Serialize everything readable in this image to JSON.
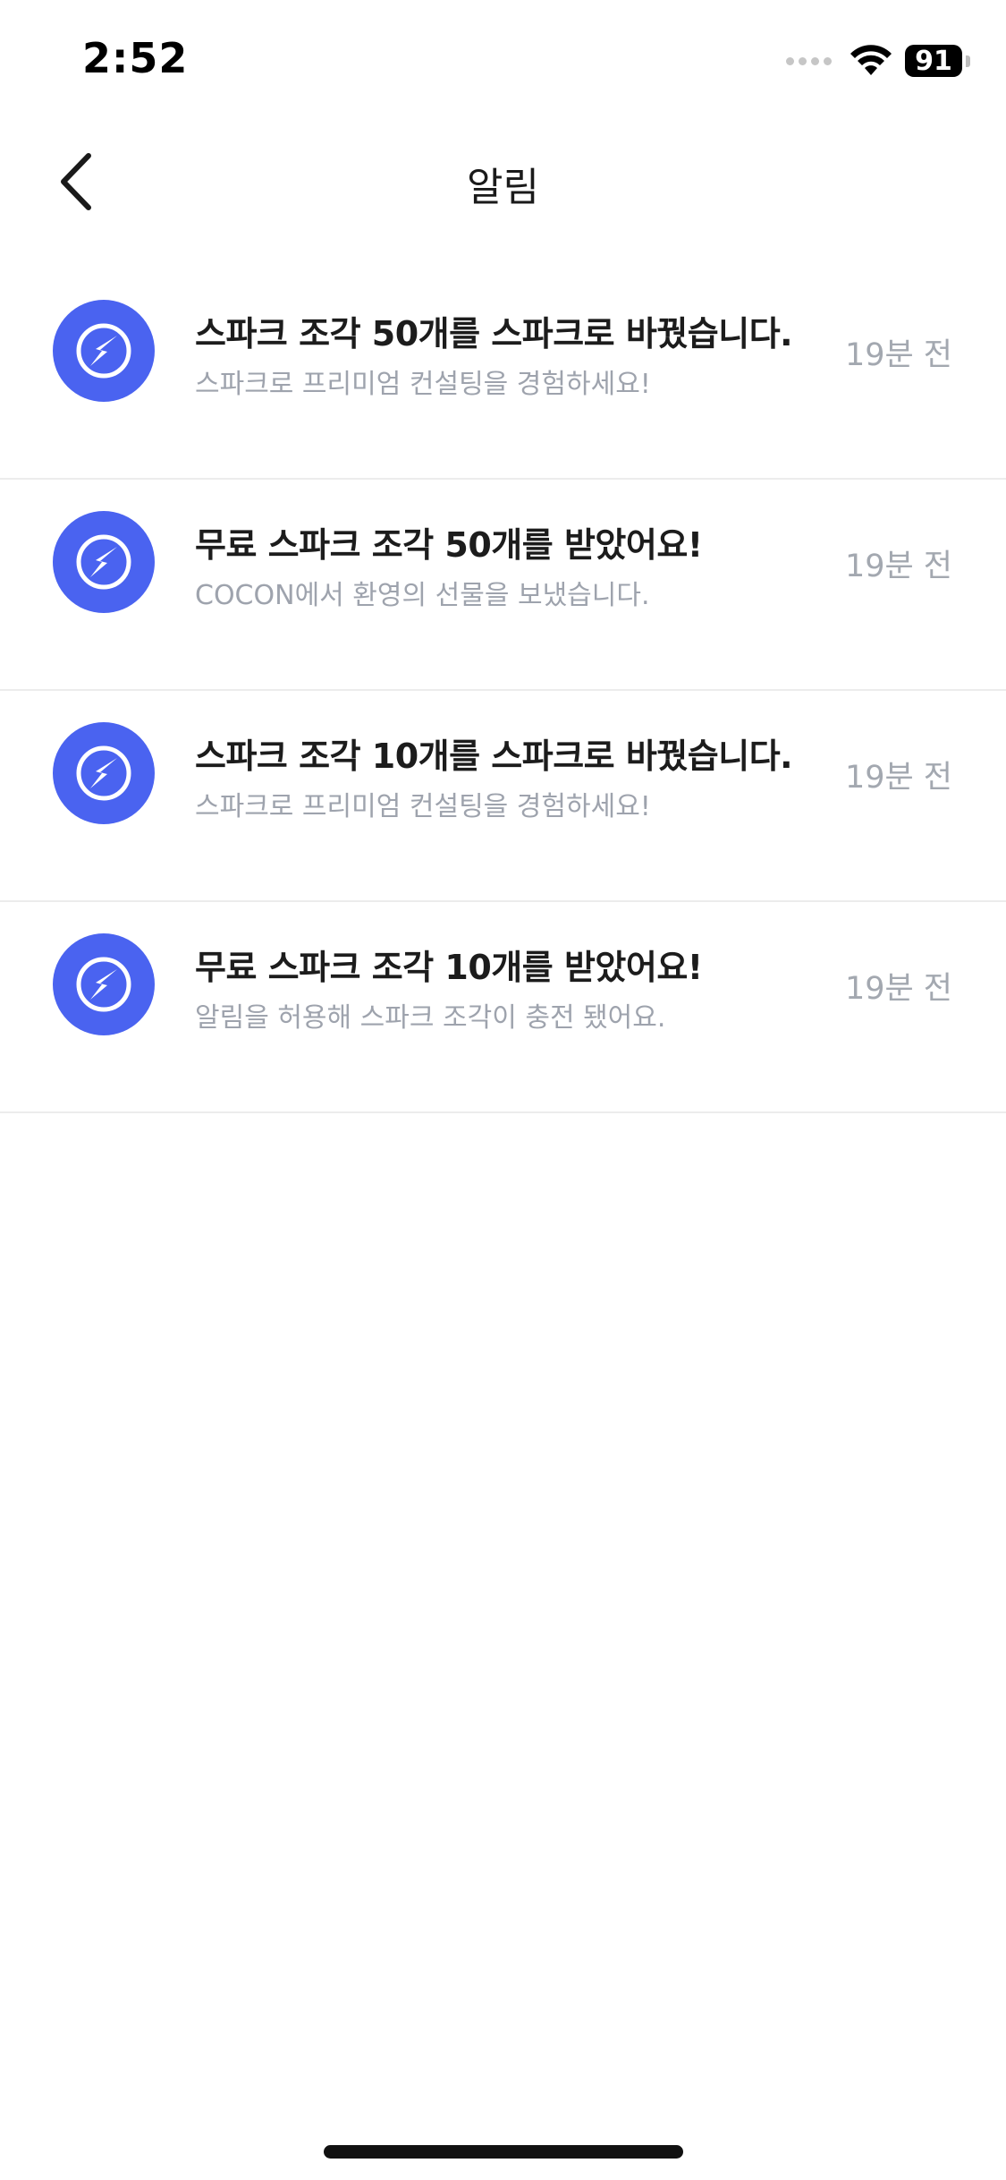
{
  "status_bar": {
    "time": "2:52",
    "battery": "91",
    "icons": [
      "cellular-signal-icon",
      "wifi-icon",
      "battery-icon"
    ]
  },
  "header": {
    "title": "알림",
    "back_icon": "chevron-left-icon"
  },
  "notifications": [
    {
      "title": "스파크 조각 50개를 스파크로 바꿨습니다.",
      "subtitle": "스파크로 프리미엄 컨설팅을 경험하세요!",
      "time": "19분 전",
      "icon": "spark-icon"
    },
    {
      "title": "무료 스파크 조각 50개를 받았어요!",
      "subtitle": "COCON에서 환영의 선물을 보냈습니다.",
      "time": "19분 전",
      "icon": "spark-icon"
    },
    {
      "title": "스파크 조각 10개를 스파크로 바꿨습니다.",
      "subtitle": "스파크로 프리미엄 컨설팅을 경험하세요!",
      "time": "19분 전",
      "icon": "spark-icon"
    },
    {
      "title": "무료 스파크 조각 10개를 받았어요!",
      "subtitle": "알림을 허용해 스파크 조각이 충전 됐어요.",
      "time": "19분 전",
      "icon": "spark-icon"
    }
  ],
  "colors": {
    "accent": "#4a63f0",
    "title_text": "#1c1c1c",
    "secondary_text": "#9ea3ad",
    "divider": "#ececec",
    "background": "#ffffff"
  }
}
